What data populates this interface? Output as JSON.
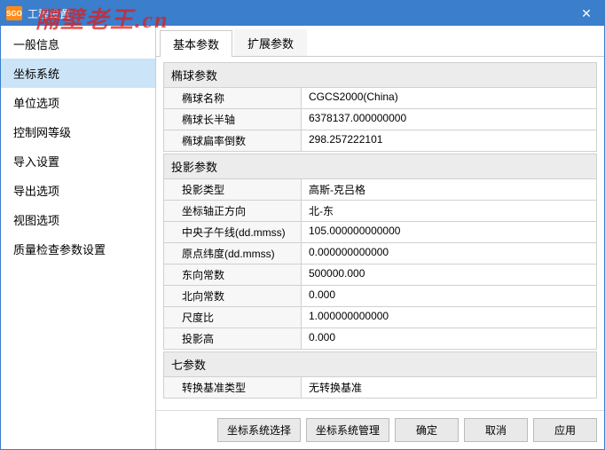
{
  "window": {
    "title": "工程设置",
    "app_icon": "SGO"
  },
  "watermark": "隔壁老王.cn",
  "sidebar": {
    "items": [
      {
        "label": "一般信息"
      },
      {
        "label": "坐标系统"
      },
      {
        "label": "单位选项"
      },
      {
        "label": "控制网等级"
      },
      {
        "label": "导入设置"
      },
      {
        "label": "导出选项"
      },
      {
        "label": "视图选项"
      },
      {
        "label": "质量检查参数设置"
      }
    ],
    "active_index": 1
  },
  "tabs": {
    "items": [
      {
        "label": "基本参数"
      },
      {
        "label": "扩展参数"
      }
    ],
    "active_index": 0
  },
  "groups": [
    {
      "header": "椭球参数",
      "rows": [
        {
          "label": "椭球名称",
          "value": "CGCS2000(China)"
        },
        {
          "label": "椭球长半轴",
          "value": "6378137.000000000"
        },
        {
          "label": "椭球扁率倒数",
          "value": "298.257222101"
        }
      ]
    },
    {
      "header": "投影参数",
      "rows": [
        {
          "label": "投影类型",
          "value": "高斯-克吕格"
        },
        {
          "label": "坐标轴正方向",
          "value": "北-东"
        },
        {
          "label": "中央子午线(dd.mmss)",
          "value": "105.000000000000"
        },
        {
          "label": "原点纬度(dd.mmss)",
          "value": "0.000000000000"
        },
        {
          "label": "东向常数",
          "value": "500000.000"
        },
        {
          "label": "北向常数",
          "value": "0.000"
        },
        {
          "label": "尺度比",
          "value": "1.000000000000"
        },
        {
          "label": "投影高",
          "value": "0.000"
        }
      ]
    },
    {
      "header": "七参数",
      "rows": [
        {
          "label": "转换基准类型",
          "value": "无转换基准"
        }
      ]
    }
  ],
  "footer": {
    "select_cs": "坐标系统选择",
    "manage_cs": "坐标系统管理",
    "ok": "确定",
    "cancel": "取消",
    "apply": "应用"
  }
}
